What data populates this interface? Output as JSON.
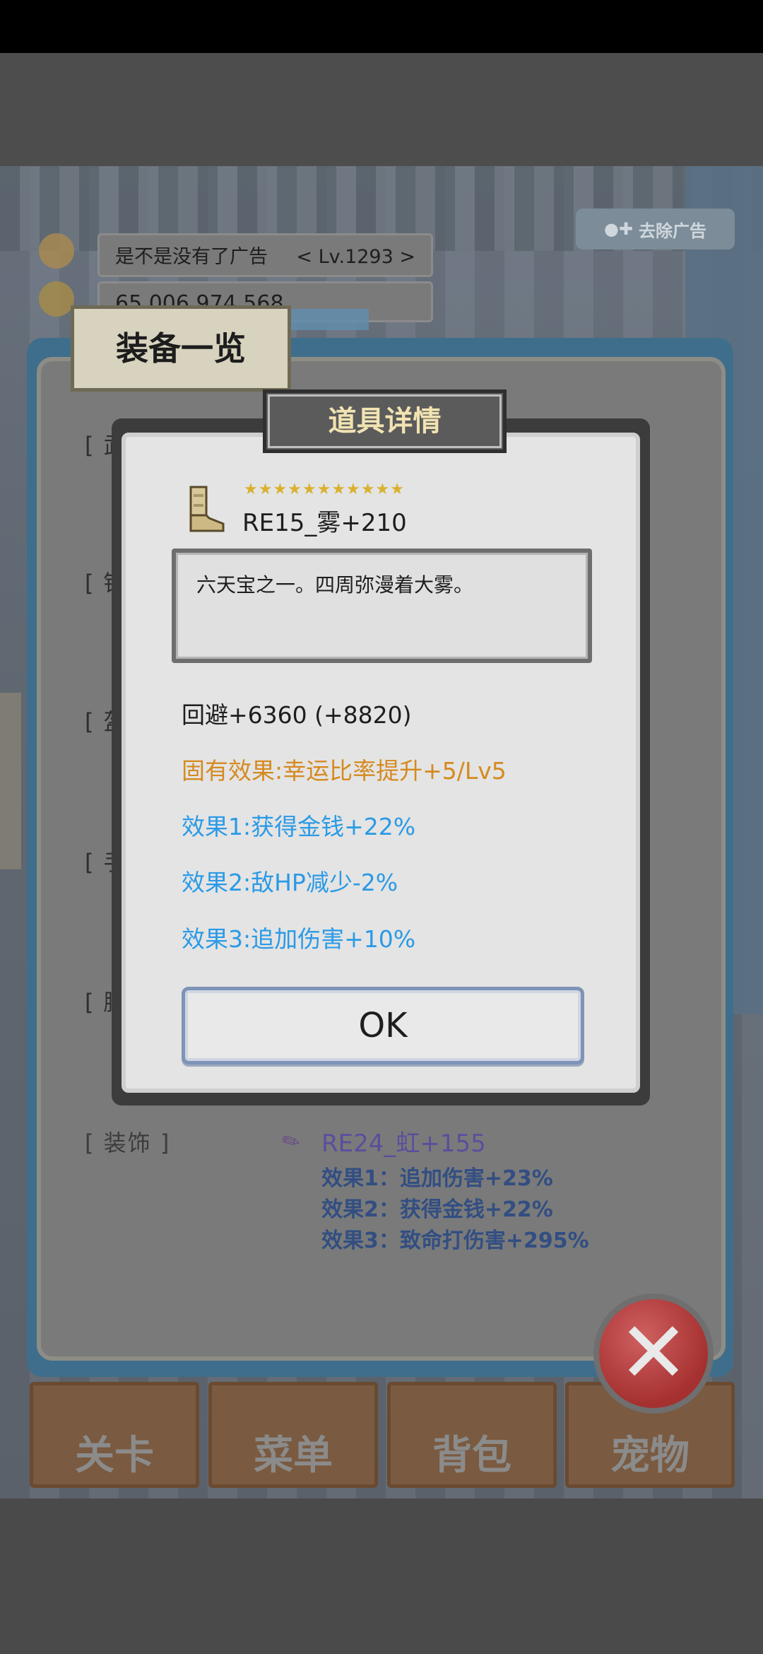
{
  "header": {
    "player_name": "是不是没有了广告",
    "level": "< Lv.1293 >",
    "gold": "65,006,974,568",
    "adfree_badge": "去除广告"
  },
  "equip_panel": {
    "title": "装备一览",
    "slots": [
      "[ 武",
      "[ 铠",
      "[ 盔",
      "[ 手",
      "[ 腰"
    ],
    "ornament": {
      "label": "[ 装饰 ]",
      "item_name": "RE24_虹+155",
      "effects": [
        "效果1：追加伤害+23%",
        "效果2：获得金钱+22%",
        "效果3：致命打伤害+295%"
      ]
    }
  },
  "dialog": {
    "title": "道具详情",
    "item_stars": "★★★★★★★★★★★",
    "item_name": "RE15_雾+210",
    "description": "六天宝之一。四周弥漫着大雾。",
    "stat": "回避+6360 (+8820)",
    "inherent": "固有效果:幸运比率提升+5/Lv5",
    "effects": [
      "效果1:获得金钱+22%",
      "效果2:敌HP减少-2%",
      "效果3:追加伤害+10%"
    ],
    "ok_label": "OK"
  },
  "nav": [
    {
      "label": "关卡"
    },
    {
      "label": "菜单"
    },
    {
      "label": "背包"
    },
    {
      "label": "宠物"
    }
  ],
  "colors": {
    "inherent": "#d58a1f",
    "effect": "#2a9ae6",
    "ornament_name": "#5a4e9c",
    "ornament_effect": "#324e82"
  }
}
